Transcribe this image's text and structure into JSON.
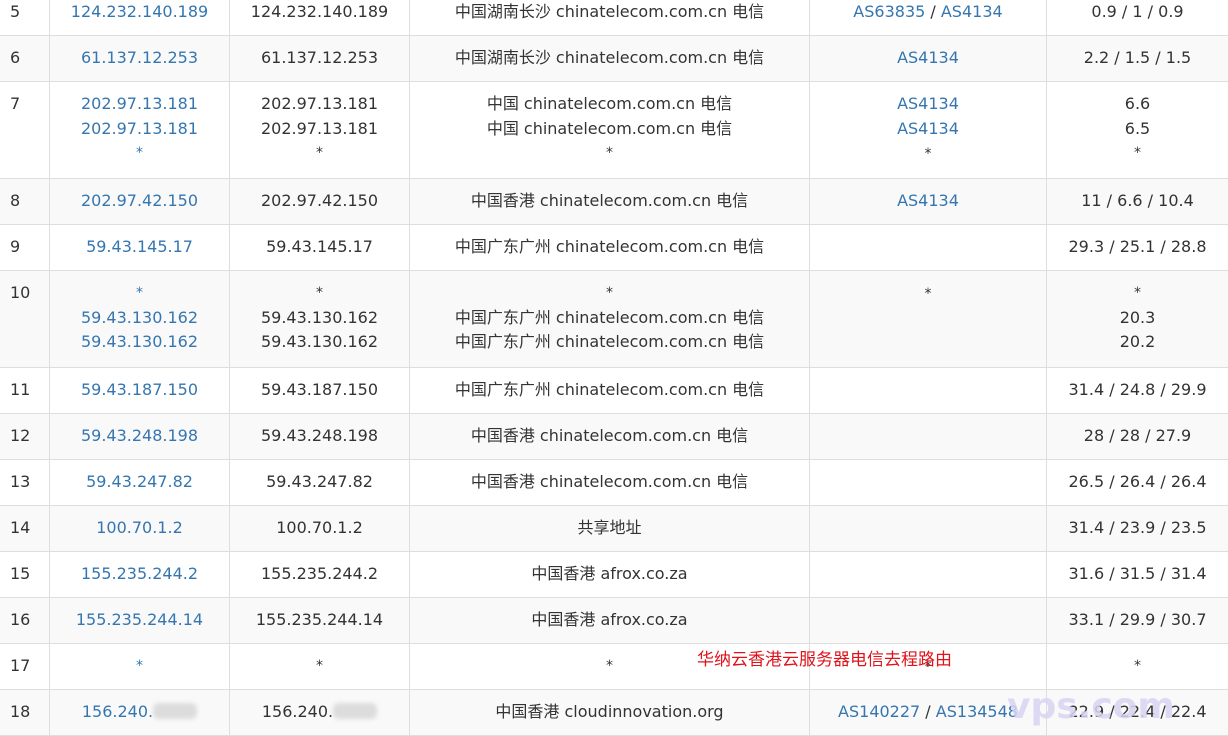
{
  "rows": [
    {
      "hop": "5",
      "height": 46,
      "ips": [
        "124.232.140.189"
      ],
      "hosts": [
        "124.232.140.189"
      ],
      "locs": [
        "中国湖南长沙 chinatelecom.com.cn 电信"
      ],
      "as": [
        [
          "AS63835",
          "AS4134"
        ]
      ],
      "rtts": [
        "0.9 / 1 / 0.9"
      ]
    },
    {
      "hop": "6",
      "height": 46,
      "ips": [
        "61.137.12.253"
      ],
      "hosts": [
        "61.137.12.253"
      ],
      "locs": [
        "中国湖南长沙 chinatelecom.com.cn 电信"
      ],
      "as": [
        [
          "AS4134"
        ]
      ],
      "rtts": [
        "2.2 / 1.5 / 1.5"
      ]
    },
    {
      "hop": "7",
      "height": 97,
      "ips": [
        "202.97.13.181",
        "202.97.13.181",
        "*"
      ],
      "hosts": [
        "202.97.13.181",
        "202.97.13.181",
        "*"
      ],
      "locs": [
        "中国 chinatelecom.com.cn 电信",
        "中国 chinatelecom.com.cn 电信",
        "*"
      ],
      "as": [
        [
          "AS4134"
        ],
        [
          "AS4134"
        ],
        [
          "*"
        ]
      ],
      "rtts": [
        "6.6",
        "6.5",
        "*"
      ]
    },
    {
      "hop": "8",
      "height": 46,
      "ips": [
        "202.97.42.150"
      ],
      "hosts": [
        "202.97.42.150"
      ],
      "locs": [
        "中国香港 chinatelecom.com.cn 电信"
      ],
      "as": [
        [
          "AS4134"
        ]
      ],
      "rtts": [
        "11 / 6.6 / 10.4"
      ]
    },
    {
      "hop": "9",
      "height": 46,
      "ips": [
        "59.43.145.17"
      ],
      "hosts": [
        "59.43.145.17"
      ],
      "locs": [
        "中国广东广州 chinatelecom.com.cn 电信"
      ],
      "as": [],
      "rtts": [
        "29.3 / 25.1 / 28.8"
      ]
    },
    {
      "hop": "10",
      "height": 97,
      "ips": [
        "*",
        "59.43.130.162",
        "59.43.130.162"
      ],
      "hosts": [
        "*",
        "59.43.130.162",
        "59.43.130.162"
      ],
      "locs": [
        "*",
        "中国广东广州 chinatelecom.com.cn 电信",
        "中国广东广州 chinatelecom.com.cn 电信"
      ],
      "as": [
        [
          "*"
        ]
      ],
      "rtts": [
        "*",
        "20.3",
        "20.2"
      ]
    },
    {
      "hop": "11",
      "height": 46,
      "ips": [
        "59.43.187.150"
      ],
      "hosts": [
        "59.43.187.150"
      ],
      "locs": [
        "中国广东广州 chinatelecom.com.cn 电信"
      ],
      "as": [],
      "rtts": [
        "31.4 / 24.8 / 29.9"
      ]
    },
    {
      "hop": "12",
      "height": 46,
      "ips": [
        "59.43.248.198"
      ],
      "hosts": [
        "59.43.248.198"
      ],
      "locs": [
        "中国香港 chinatelecom.com.cn 电信"
      ],
      "as": [],
      "rtts": [
        "28 / 28 / 27.9"
      ]
    },
    {
      "hop": "13",
      "height": 46,
      "ips": [
        "59.43.247.82"
      ],
      "hosts": [
        "59.43.247.82"
      ],
      "locs": [
        "中国香港 chinatelecom.com.cn 电信"
      ],
      "as": [],
      "rtts": [
        "26.5 / 26.4 / 26.4"
      ]
    },
    {
      "hop": "14",
      "height": 46,
      "ips": [
        "100.70.1.2"
      ],
      "hosts": [
        "100.70.1.2"
      ],
      "locs": [
        "共享地址"
      ],
      "as": [],
      "rtts": [
        "31.4 / 23.9 / 23.5"
      ]
    },
    {
      "hop": "15",
      "height": 46,
      "ips": [
        "155.235.244.2"
      ],
      "hosts": [
        "155.235.244.2"
      ],
      "locs": [
        "中国香港 afrox.co.za"
      ],
      "as": [],
      "rtts": [
        "31.6 / 31.5 / 31.4"
      ]
    },
    {
      "hop": "16",
      "height": 46,
      "ips": [
        "155.235.244.14"
      ],
      "hosts": [
        "155.235.244.14"
      ],
      "locs": [
        "中国香港 afrox.co.za"
      ],
      "as": [],
      "rtts": [
        "33.1 / 29.9 / 30.7"
      ]
    },
    {
      "hop": "17",
      "height": 46,
      "ips": [
        "*"
      ],
      "hosts": [
        "*"
      ],
      "locs": [
        "*"
      ],
      "as": [
        [
          "*"
        ]
      ],
      "rtts": [
        "*"
      ]
    },
    {
      "hop": "18",
      "height": 46,
      "ips": [
        "156.240."
      ],
      "hosts": [
        "156.240."
      ],
      "locs": [
        "中国香港 cloudinnovation.org"
      ],
      "as": [
        [
          "AS140227",
          "AS134548"
        ]
      ],
      "rtts": [
        "22.9 / 22.4 / 22.4"
      ],
      "redacted": true
    }
  ],
  "watermark": {
    "caption": "华纳云香港云服务器电信去程路由",
    "logo": "vps.com",
    "color": "#e0131b"
  },
  "colors": {
    "link": "#3576b0",
    "border": "#dedede",
    "stripe": "#f9f9f9"
  }
}
